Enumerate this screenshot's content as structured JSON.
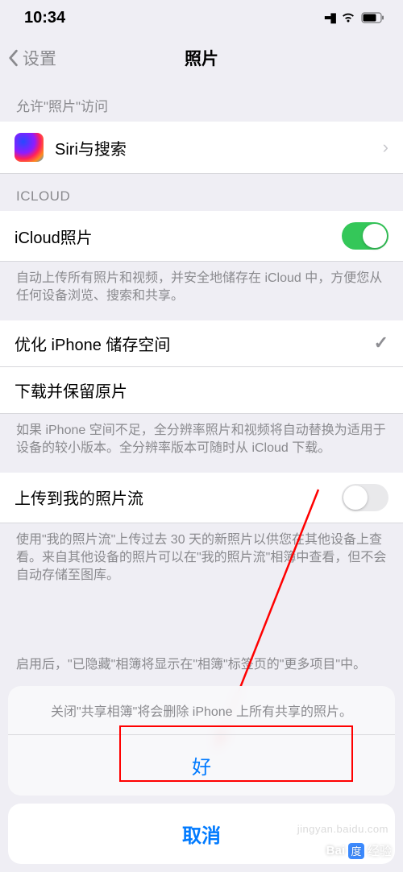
{
  "status": {
    "time": "10:34"
  },
  "nav": {
    "back": "设置",
    "title": "照片"
  },
  "section_access": {
    "header": "允许\"照片\"访问"
  },
  "siri": {
    "label": "Siri与搜索"
  },
  "section_icloud": {
    "header": "ICLOUD"
  },
  "icloud_photos": {
    "label": "iCloud照片"
  },
  "icloud_footer": "自动上传所有照片和视频，并安全地储存在 iCloud 中，方便您从任何设备浏览、搜索和共享。",
  "optimize": {
    "label": "优化 iPhone 储存空间"
  },
  "download": {
    "label": "下载并保留原片"
  },
  "storage_footer": "如果 iPhone 空间不足，全分辨率照片和视频将自动替换为适用于设备的较小版本。全分辨率版本可随时从 iCloud 下载。",
  "mystream": {
    "label": "上传到我的照片流"
  },
  "mystream_footer": "使用\"我的照片流\"上传过去 30 天的新照片以供您在其他设备上查看。来自其他设备的照片可以在\"我的照片流\"相簿中查看，但不会自动存储至图库。",
  "hidden_footer": "启用后，\"已隐藏\"相簿将显示在\"相簿\"标签页的\"更多项目\"中。",
  "sheet": {
    "message": "关闭\"共享相簿\"将会删除 iPhone 上所有共享的照片。",
    "ok": "好",
    "cancel": "取消"
  },
  "watermark": {
    "small": "jingyan.baidu.com",
    "logo": "经验"
  }
}
